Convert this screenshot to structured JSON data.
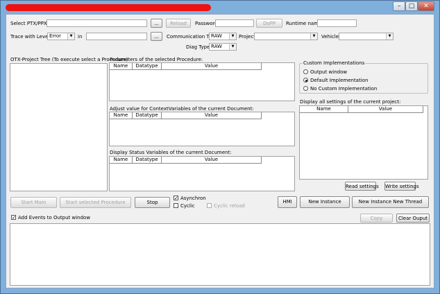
{
  "window": {
    "controls": {
      "minimize": "–",
      "maximize": "□",
      "close": "✕"
    }
  },
  "row1": {
    "select_label": "Select PTX/PPX:",
    "browse_label": "...",
    "reload_label": "Reload",
    "password_label": "Password:",
    "dopp_label": "DoPP",
    "runtime_label": "Runtime name:"
  },
  "row2": {
    "trace_label": "Trace with Level",
    "trace_value": "Error",
    "in_label": "in",
    "browse_label": "...",
    "comm_label": "Communication Type",
    "comm_value": "RAW",
    "project_label": "Project:",
    "vehicle_label": "Vehicle:"
  },
  "row3": {
    "diag_label": "Diag Type:",
    "diag_value": "RAW"
  },
  "tree": {
    "title": "OTX-Project Tree (To execute select a Procedure)"
  },
  "params": {
    "title": "Parameters of the selected Procedure:"
  },
  "context": {
    "title": "Adjust value for ContextVariables of the current Document:"
  },
  "status": {
    "title": "Display Status Variables of the current Document:"
  },
  "grid_columns": {
    "name": "Name",
    "datatype": "Datatype",
    "value": "Value"
  },
  "custom": {
    "title": "Custom Implementations",
    "options": [
      "Output window",
      "Default Implementation",
      "No Custom Implementation"
    ]
  },
  "settings": {
    "title": "Display all settings of the current project:",
    "col_name": "Name",
    "col_value": "Value",
    "read_label": "Read settings",
    "write_label": "Write settings"
  },
  "actions": {
    "start_main": "Start Main",
    "start_selected": "Start selected Procedure",
    "stop": "Stop",
    "asynchron": "Asynchron",
    "cyclic": "Cyclic",
    "cyclic_reload": "Cyclic reload",
    "hmi": "HMI",
    "new_instance": "New Instance",
    "new_instance_thread": "New Instance New Thread"
  },
  "output": {
    "add_events": "Add Events to Output window",
    "copy": "Copy",
    "clear": "Clear Ouput"
  },
  "check_mark": "✓"
}
